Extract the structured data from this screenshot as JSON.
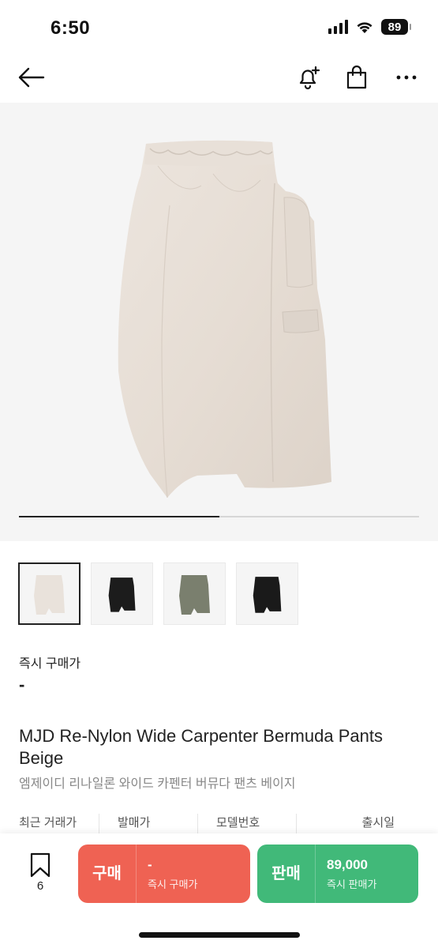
{
  "status": {
    "time": "6:50",
    "battery": "89"
  },
  "nav": {
    "back_icon": "arrow-left-icon",
    "bell_icon": "bell-plus-icon",
    "bag_icon": "shopping-bag-icon",
    "more_icon": "more-horizontal-icon"
  },
  "hero": {
    "product_color": "#e9e2db",
    "progress": 0.5
  },
  "thumbnails": [
    {
      "color": "#e9e2db",
      "selected": true
    },
    {
      "color": "#1c1c1c",
      "selected": false
    },
    {
      "color": "#7a7f6e",
      "selected": false
    },
    {
      "color": "#1a1a1a",
      "selected": false
    }
  ],
  "price": {
    "label": "즉시 구매가",
    "value": "-"
  },
  "product": {
    "title_en": "MJD Re-Nylon Wide Carpenter Bermuda Pants Beige",
    "title_kr": "엠제이디 리나일론 와이드 카펜터 버뮤다 팬츠 베이지"
  },
  "info": {
    "recent": "최근 거래가",
    "release_price": "발매가",
    "model": "모델번호",
    "release_date": "출시일"
  },
  "bottom": {
    "wish_count": "6",
    "buy": {
      "label": "구매",
      "price": "-",
      "sub": "즉시 구매가"
    },
    "sell": {
      "label": "판매",
      "price": "89,000",
      "sub": "즉시 판매가"
    }
  },
  "colors": {
    "buy": "#ef6253",
    "sell": "#41b979"
  }
}
